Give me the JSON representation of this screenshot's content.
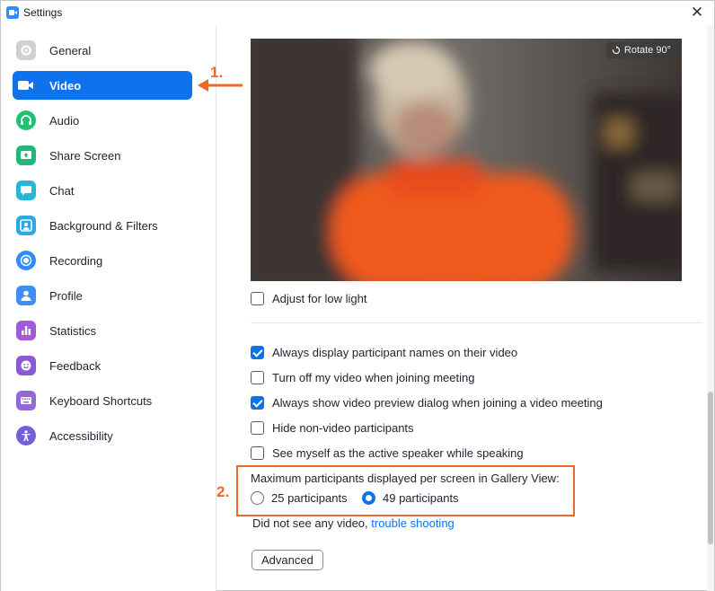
{
  "window": {
    "title": "Settings",
    "close_glyph": "✕"
  },
  "sidebar": {
    "items": [
      {
        "label": "General",
        "icon": "gear-icon"
      },
      {
        "label": "Video",
        "icon": "video-camera-icon",
        "active": true
      },
      {
        "label": "Audio",
        "icon": "headphones-icon"
      },
      {
        "label": "Share Screen",
        "icon": "share-screen-icon"
      },
      {
        "label": "Chat",
        "icon": "chat-bubble-icon"
      },
      {
        "label": "Background & Filters",
        "icon": "background-person-icon"
      },
      {
        "label": "Recording",
        "icon": "record-icon"
      },
      {
        "label": "Profile",
        "icon": "person-icon"
      },
      {
        "label": "Statistics",
        "icon": "bar-chart-icon"
      },
      {
        "label": "Feedback",
        "icon": "smiley-icon"
      },
      {
        "label": "Keyboard Shortcuts",
        "icon": "keyboard-icon"
      },
      {
        "label": "Accessibility",
        "icon": "accessibility-icon"
      }
    ]
  },
  "annotations": {
    "step1": "1.",
    "step2": "2.",
    "accent_color": "#ea6b27"
  },
  "video": {
    "rotate_label": "Rotate 90°",
    "adjust_low_light": {
      "label": "Adjust for low light",
      "checked": false
    },
    "options": [
      {
        "label": "Always display participant names on their video",
        "checked": true
      },
      {
        "label": "Turn off my video when joining meeting",
        "checked": false
      },
      {
        "label": "Always show video preview dialog when joining a video meeting",
        "checked": true
      },
      {
        "label": "Hide non-video participants",
        "checked": false
      },
      {
        "label": "See myself as the active speaker while speaking",
        "checked": false
      }
    ],
    "gallery": {
      "label": "Maximum participants displayed per screen in Gallery View:",
      "options": [
        {
          "label": "25 participants",
          "selected": false
        },
        {
          "label": "49 participants",
          "selected": true
        }
      ]
    },
    "trouble_text": "Did not see any video,",
    "trouble_link": "trouble shooting",
    "advanced_label": "Advanced"
  },
  "colors": {
    "accent_blue": "#0e72ed",
    "annotation_orange": "#ea6b27"
  }
}
